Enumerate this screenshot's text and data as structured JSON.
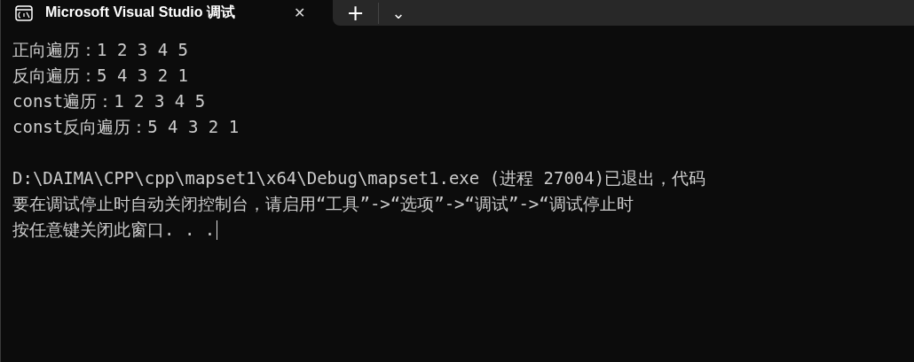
{
  "tab": {
    "title": "Microsoft Visual Studio 调试",
    "close": "✕",
    "selected": true
  },
  "new_tab": "+",
  "dropdown": "⌄",
  "output_lines": [
    "正向遍历：1 2 3 4 5",
    "反向遍历：5 4 3 2 1",
    "const遍历：1 2 3 4 5",
    "const反向遍历：5 4 3 2 1"
  ],
  "exit_lines": [
    "D:\\DAIMA\\CPP\\cpp\\mapset1\\x64\\Debug\\mapset1.exe (进程 27004)已退出，代码",
    "要在调试停止时自动关闭控制台，请启用“工具”->“选项”->“调试”->“调试停止时",
    "按任意键关闭此窗口. . ."
  ],
  "cursor": true
}
